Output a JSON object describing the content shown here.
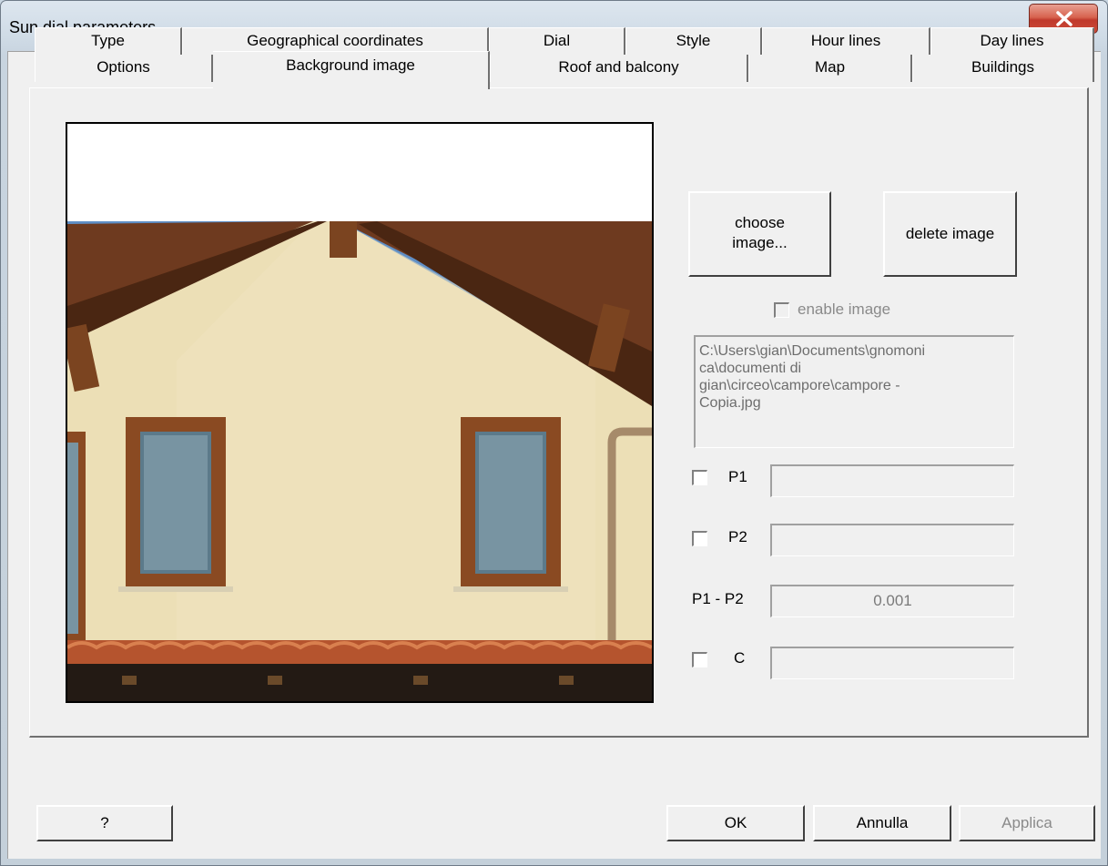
{
  "window": {
    "title": "Sun dial parameters"
  },
  "tabs_row1": [
    "Type",
    "Geographical coordinates",
    "Dial",
    "Style",
    "Hour lines",
    "Day lines"
  ],
  "tabs_row2": [
    "Options",
    "Background image",
    "Roof and balcony",
    "Map",
    "Buildings"
  ],
  "active_tab": "Background image",
  "buttons": {
    "choose_line1": "choose",
    "choose_line2": "image...",
    "delete": "delete image",
    "help": "?",
    "ok": "OK",
    "cancel": "Annulla",
    "apply": "Applica"
  },
  "enable_image": {
    "label": "enable image",
    "checked": false,
    "enabled": false
  },
  "file_path": "C:\\Users\\gian\\Documents\\gnomonica\\documenti di gian\\circeo\\campore\\campore - Copia.jpg",
  "file_path_lines": [
    "C:\\Users\\gian\\Documents\\gnomoni",
    "ca\\documenti di",
    "gian\\circeo\\campore\\campore -",
    "Copia.jpg"
  ],
  "points": {
    "p1": {
      "label": "P1",
      "checked": false,
      "value": ""
    },
    "p2": {
      "label": "P2",
      "checked": false,
      "value": ""
    },
    "p1p2": {
      "label": "P1 - P2",
      "value": "0.001"
    },
    "c": {
      "label": "C",
      "checked": false,
      "value": ""
    }
  },
  "colors": {
    "close_button": "#c0392b",
    "face": "#f0f0f0"
  }
}
